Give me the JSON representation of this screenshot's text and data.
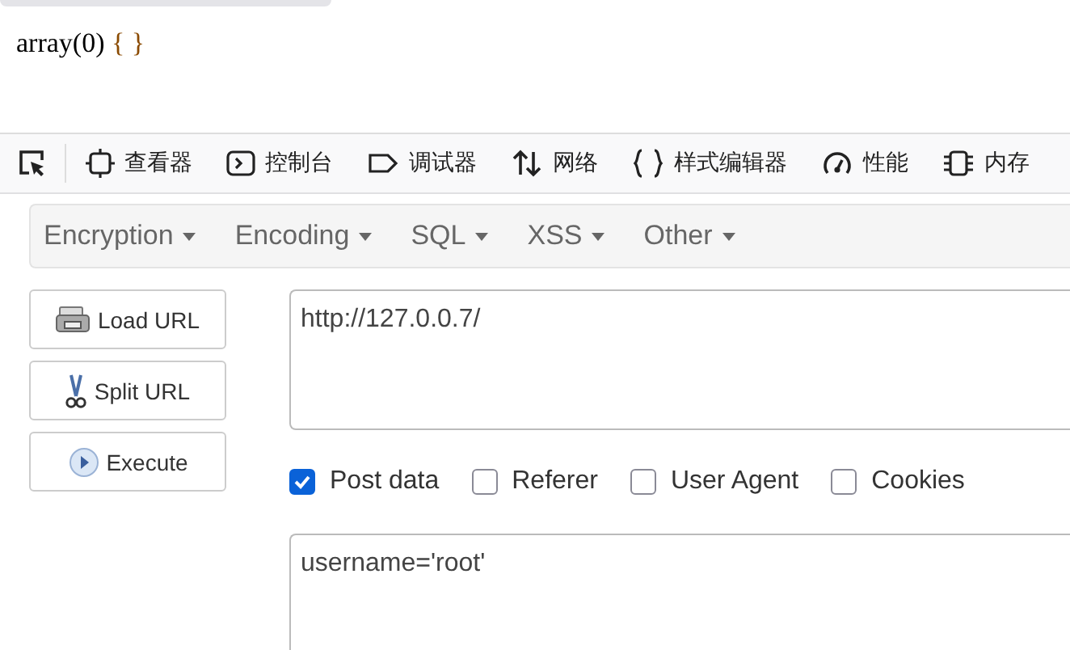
{
  "page": {
    "output": "array(0)",
    "braces": "{ }"
  },
  "devtools": {
    "tabs": [
      {
        "label": "查看器",
        "selected": false
      },
      {
        "label": "控制台",
        "selected": false
      },
      {
        "label": "调试器",
        "selected": false
      },
      {
        "label": "网络",
        "selected": false
      },
      {
        "label": "样式编辑器",
        "selected": false
      },
      {
        "label": "性能",
        "selected": false
      },
      {
        "label": "内存",
        "selected": false
      }
    ]
  },
  "hackbar": {
    "menus": [
      "Encryption",
      "Encoding",
      "SQL",
      "XSS",
      "Other"
    ],
    "buttons": [
      {
        "label": "Load URL"
      },
      {
        "label": "Split URL"
      },
      {
        "label": "Execute"
      }
    ],
    "url": "http://127.0.0.7/",
    "options": [
      {
        "label": "Post data",
        "checked": true
      },
      {
        "label": "Referer",
        "checked": false
      },
      {
        "label": "User Agent",
        "checked": false
      },
      {
        "label": "Cookies",
        "checked": false
      }
    ],
    "post_data": "username='root'"
  }
}
